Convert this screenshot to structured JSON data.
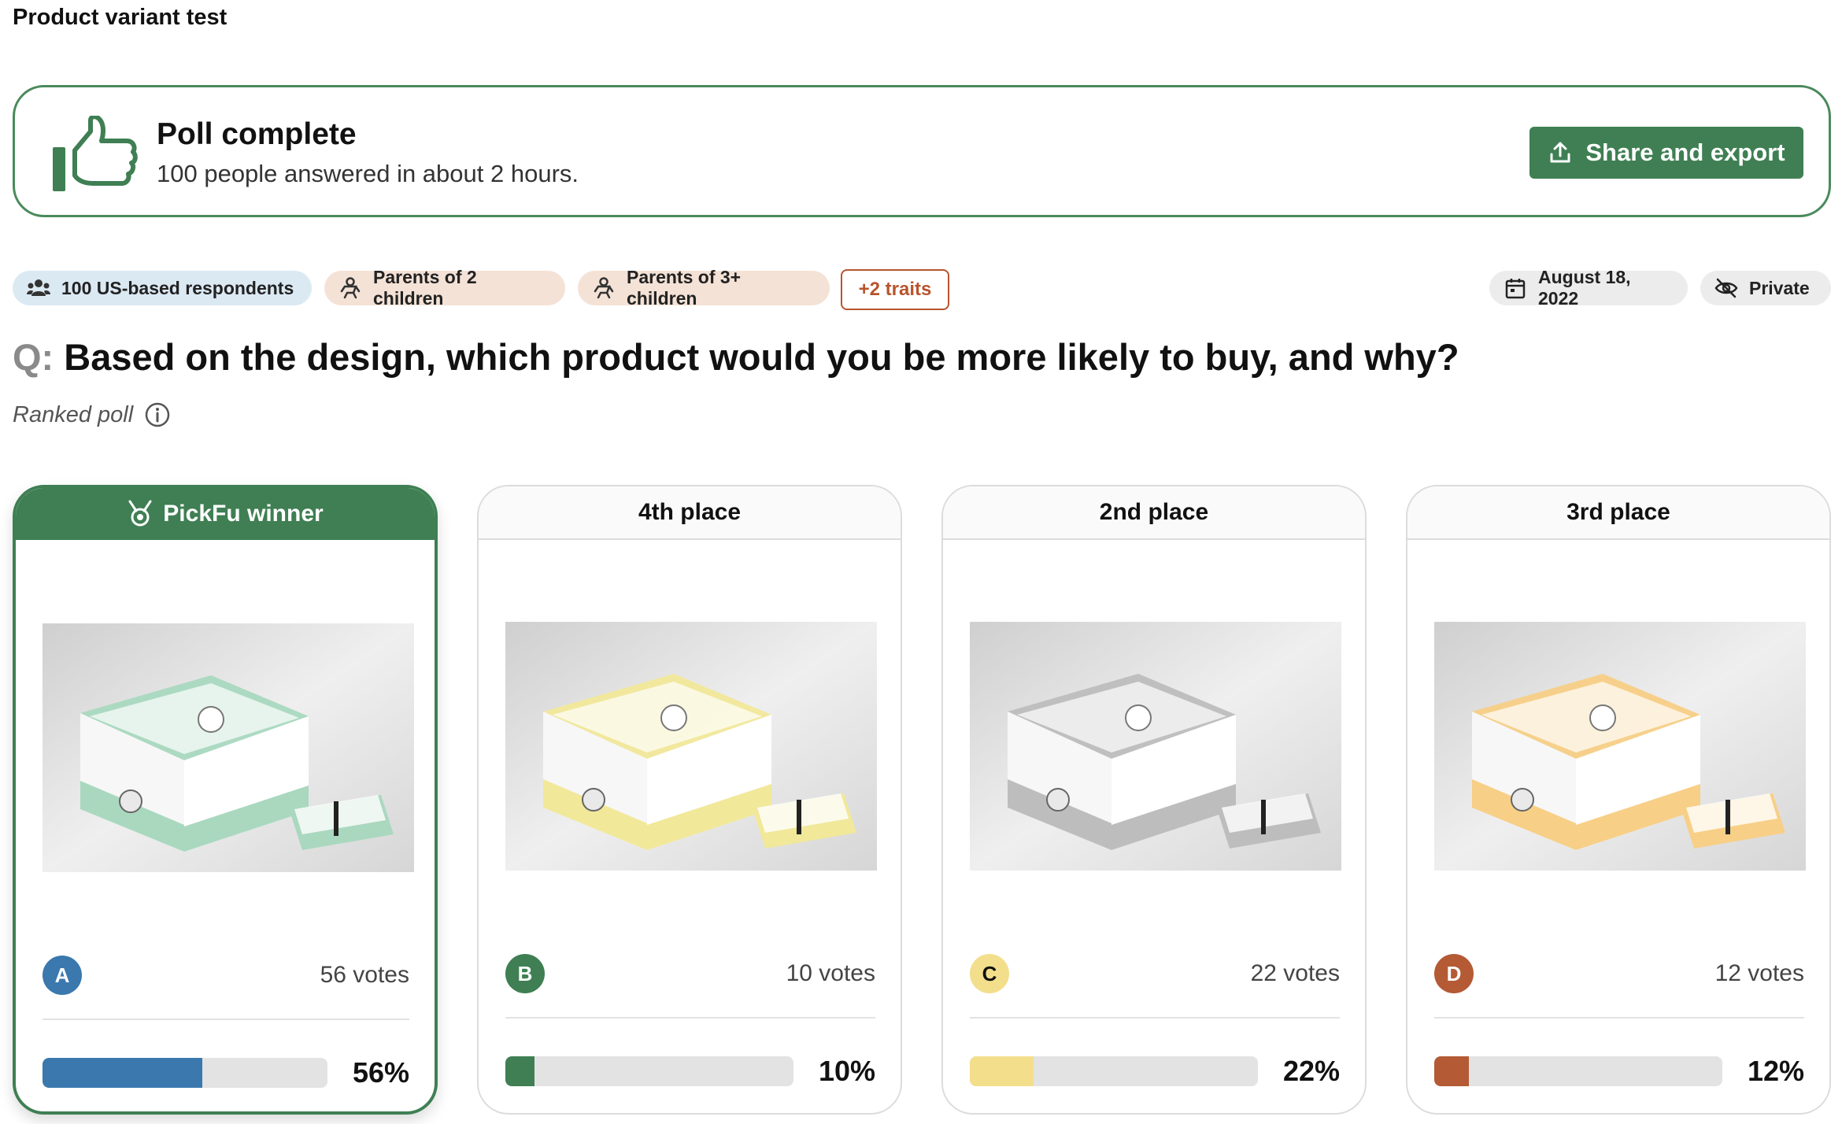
{
  "page": {
    "title": "Product variant test"
  },
  "banner": {
    "icon": "thumbs-up-icon",
    "title": "Poll complete",
    "subtitle": "100 people answered in about 2 hours.",
    "share_label": "Share and export"
  },
  "chips": {
    "respondents": "100 US-based respondents",
    "trait1": "Parents of 2 children",
    "trait2": "Parents of 3+ children",
    "more_traits": "+2 traits",
    "date": "August 18, 2022",
    "visibility": "Private"
  },
  "question": {
    "prefix": "Q:",
    "text": "Based on the design, which product would you be more likely to buy, and why?",
    "poll_type": "Ranked poll"
  },
  "options": [
    {
      "place": "PickFu winner",
      "letter": "A",
      "votes": "56 votes",
      "percent_label": "56%",
      "share": 0.56,
      "color": "#3a78ae",
      "box_color": "#a9d8bf"
    },
    {
      "place": "4th place",
      "letter": "B",
      "votes": "10 votes",
      "percent_label": "10%",
      "share": 0.1,
      "color": "#3f7f53",
      "box_color": "#f1e89a"
    },
    {
      "place": "2nd place",
      "letter": "C",
      "votes": "22 votes",
      "percent_label": "22%",
      "share": 0.22,
      "color": "#f3de8c",
      "box_color": "#bdbdbd"
    },
    {
      "place": "3rd place",
      "letter": "D",
      "votes": "12 votes",
      "percent_label": "12%",
      "share": 0.12,
      "color": "#b45a35",
      "box_color": "#f7cf86"
    }
  ],
  "colors": {
    "brand_green": "#3f7f53",
    "trait_accent": "#b8542c"
  }
}
